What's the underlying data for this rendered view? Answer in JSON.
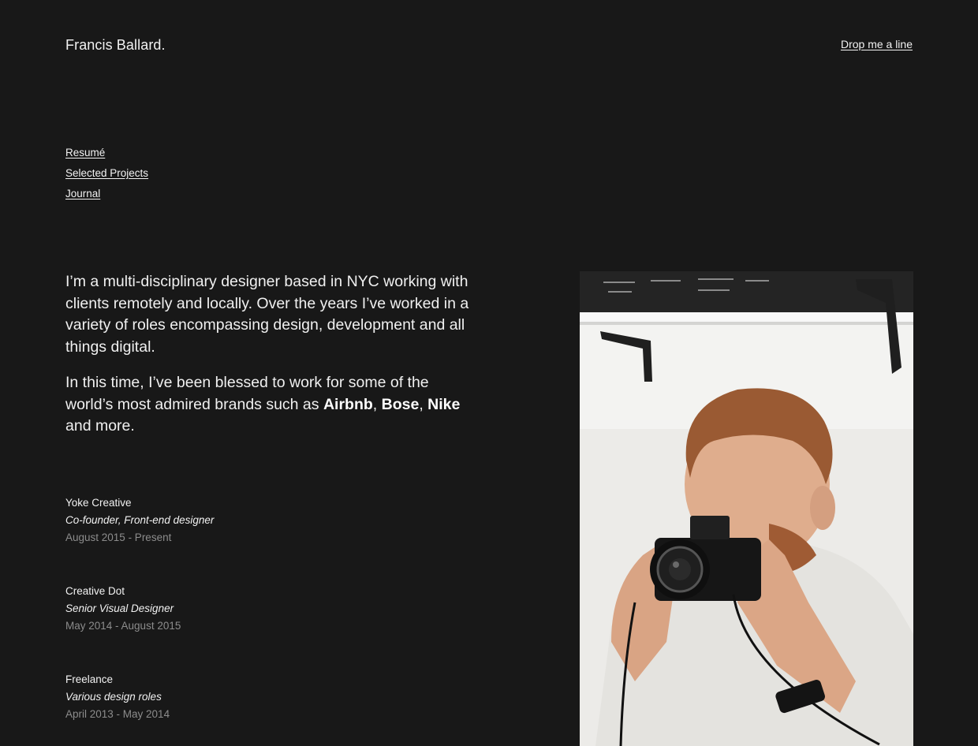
{
  "header": {
    "brand": "Francis Ballard.",
    "contact_link": "Drop me a line"
  },
  "nav": {
    "items": [
      {
        "label": "Resumé"
      },
      {
        "label": "Selected Projects"
      },
      {
        "label": "Journal"
      }
    ]
  },
  "intro": {
    "paragraph1": "I’m a multi-disciplinary designer based in NYC working with clients remotely and locally. Over the years I’ve worked in a variety of roles encompassing design, development and all things digital.",
    "paragraph2_prefix": "In this time, I’ve been blessed to work for some of the world’s most admired brands such as ",
    "brands": [
      "Airbnb",
      "Bose",
      "Nike"
    ],
    "separator": ", ",
    "paragraph2_suffix": " and more."
  },
  "experience": [
    {
      "company": "Yoke Creative",
      "role": "Co-founder, Front-end designer",
      "dates": "August 2015 - Present"
    },
    {
      "company": "Creative Dot",
      "role": "Senior Visual Designer",
      "dates": "May 2014 - August 2015"
    },
    {
      "company": "Freelance",
      "role": "Various design roles",
      "dates": "April 2013 - May 2014"
    }
  ],
  "photo": {
    "subject": "man-with-camera-photo"
  },
  "colors": {
    "background": "#181818",
    "text": "#f2f2f2",
    "muted": "#8c8c8c"
  }
}
